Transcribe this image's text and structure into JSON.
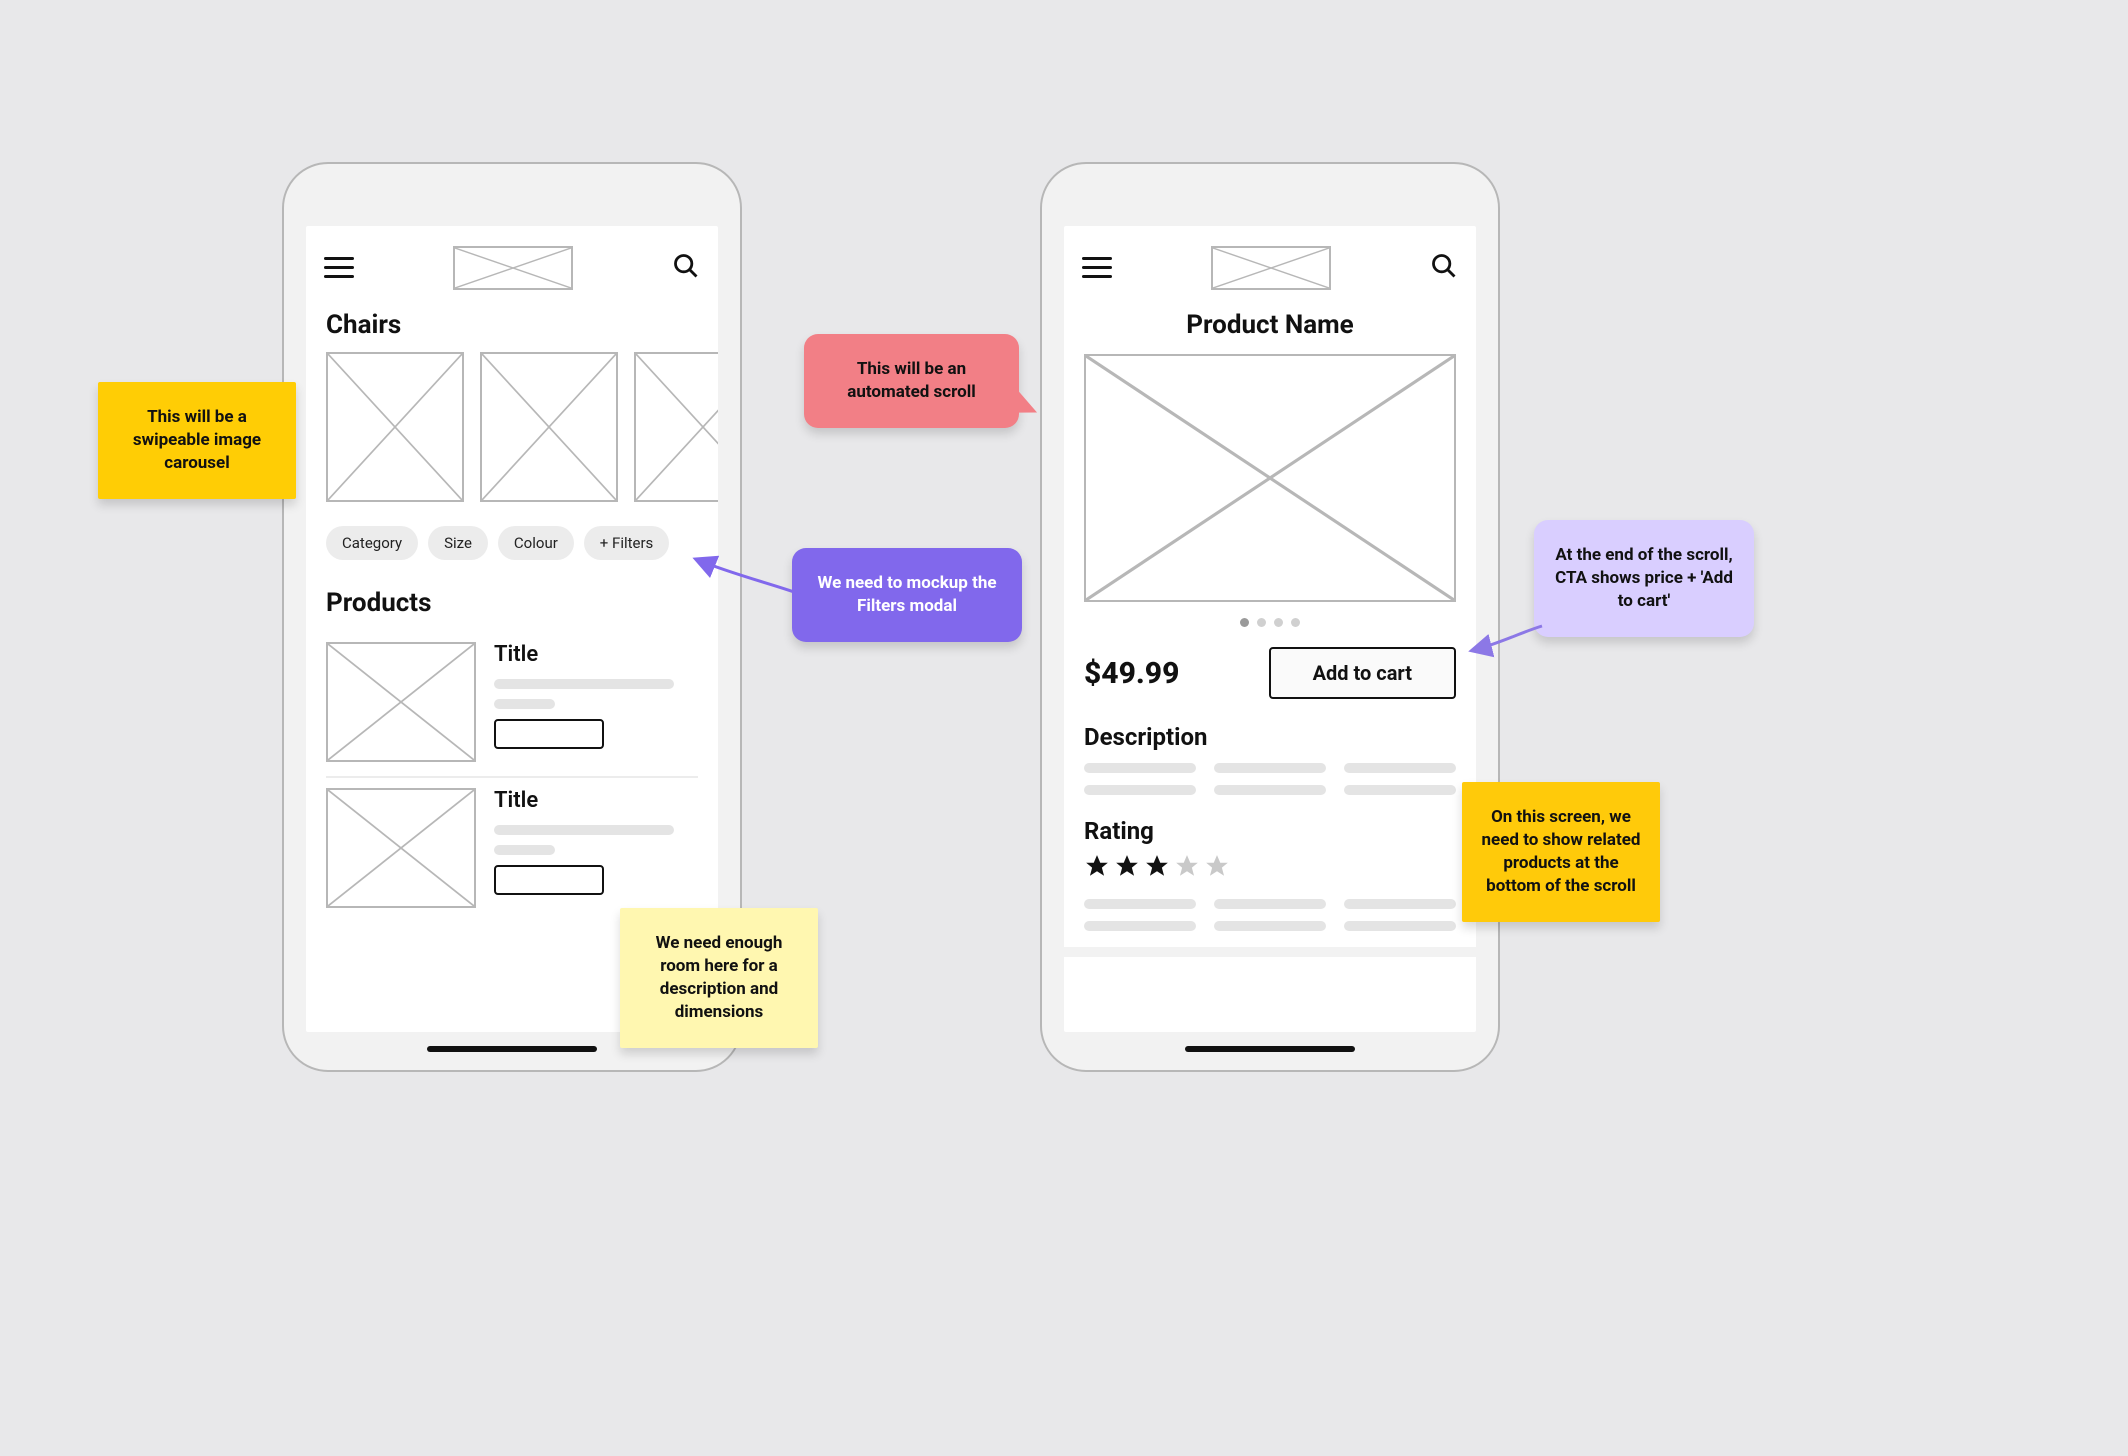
{
  "screenA": {
    "category_title": "Chairs",
    "filter_chips": [
      "Category",
      "Size",
      "Colour",
      "+ Filters"
    ],
    "products_title": "Products",
    "products": [
      {
        "title": "Title"
      },
      {
        "title": "Title"
      }
    ]
  },
  "screenB": {
    "product_name": "Product Name",
    "carousel_dots": 4,
    "carousel_active_index": 0,
    "price": "$49.99",
    "cta_label": "Add to cart",
    "description_heading": "Description",
    "rating_heading": "Rating",
    "rating_value": 3,
    "rating_max": 5
  },
  "notes": {
    "carousel_note": "This will be a swipeable image carousel",
    "filters_note": "We need to mockup the Filters modal",
    "room_note": "We need enough room here for a description and dimensions",
    "auto_scroll_note": "This will be an automated scroll",
    "cta_note": "At the end of the scroll, CTA shows price + 'Add to cart'",
    "related_note": "On this screen, we need to show related products at the bottom of the scroll"
  },
  "colors": {
    "note_yellow": "#ffcd05",
    "note_cream": "#fff7b0",
    "note_gold": "#ffca0a",
    "note_purple": "#8168ec",
    "note_lavender": "#d9ceff",
    "note_coral": "#f27f86"
  }
}
